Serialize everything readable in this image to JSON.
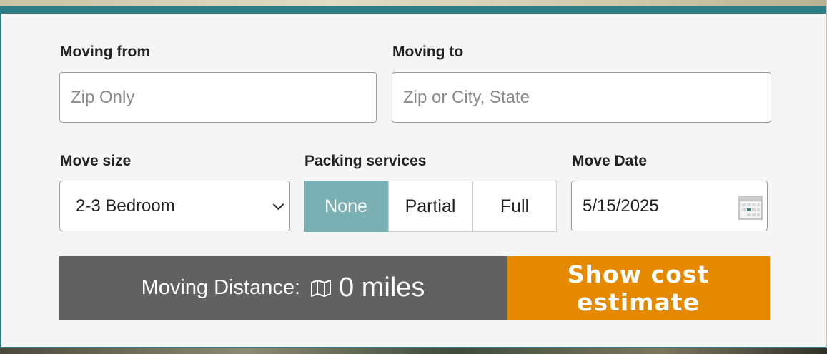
{
  "form": {
    "moving_from": {
      "label": "Moving from",
      "placeholder": "Zip Only"
    },
    "moving_to": {
      "label": "Moving to",
      "placeholder": "Zip or City, State"
    },
    "move_size": {
      "label": "Move size",
      "value": "2-3 Bedroom"
    },
    "packing": {
      "label": "Packing services",
      "options": [
        "None",
        "Partial",
        "Full"
      ],
      "selected": "None"
    },
    "move_date": {
      "label": "Move Date",
      "value": "5/15/2025",
      "icon": "calendar-icon"
    }
  },
  "footer": {
    "distance_label": "Moving Distance:",
    "distance_icon": "map-icon",
    "distance_value": "0 miles",
    "cta_label": "Show cost estimate"
  },
  "colors": {
    "accent_teal": "#2e7c86",
    "selected_segment": "#7ab0b4",
    "cta_orange": "#e58a00",
    "distance_bar": "#616161"
  }
}
